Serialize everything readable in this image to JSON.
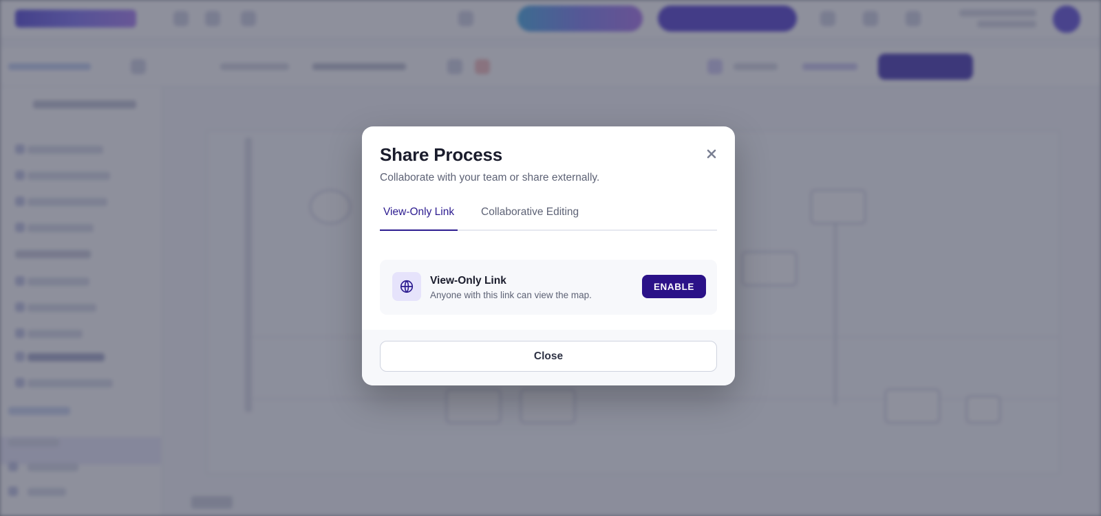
{
  "dialog": {
    "title": "Share Process",
    "subtitle": "Collaborate with your team or share externally.",
    "close_icon": "close-icon",
    "tabs": [
      {
        "label": "View-Only Link",
        "active": true
      },
      {
        "label": "Collaborative Editing",
        "active": false
      }
    ],
    "share_option": {
      "icon": "globe-icon",
      "title": "View-Only Link",
      "description": "Anyone with this link can view the map.",
      "action_label": "ENABLE"
    },
    "footer": {
      "close_label": "Close"
    }
  },
  "colors": {
    "accent": "#2b1288",
    "tab_active": "#2b1a8f",
    "overlay": "#484c60"
  }
}
